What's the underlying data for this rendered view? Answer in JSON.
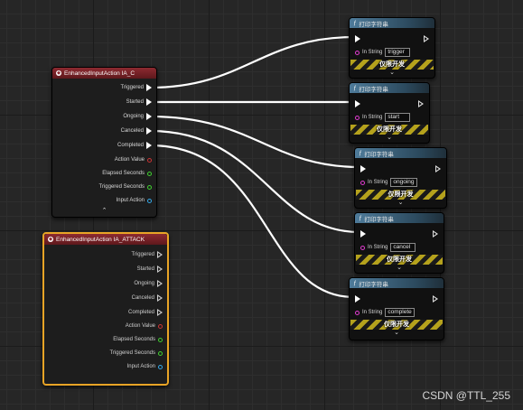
{
  "nodes": {
    "ia_c": {
      "title": "EnhancedInputAction IA_C",
      "pins": [
        "Triggered",
        "Started",
        "Ongoing",
        "Canceled",
        "Completed",
        "Action Value",
        "Elapsed Seconds",
        "Triggered Seconds",
        "Input Action"
      ],
      "collapse_glyph": "⌃"
    },
    "ia_attack": {
      "title": "EnhancedInputAction IA_ATTACK",
      "pins": [
        "Triggered",
        "Started",
        "Ongoing",
        "Canceled",
        "Completed",
        "Action Value",
        "Elapsed Seconds",
        "Triggered Seconds",
        "Input Action"
      ],
      "collapse_glyph": "⌃"
    },
    "print_nodes": [
      {
        "title": "打印字符串",
        "in_label": "In String",
        "value": "trigger",
        "dev_label": "仅限开发",
        "chev": "⌄"
      },
      {
        "title": "打印字符串",
        "in_label": "In String",
        "value": "start",
        "dev_label": "仅限开发",
        "chev": "⌄"
      },
      {
        "title": "打印字符串",
        "in_label": "In String",
        "value": "ongoing",
        "dev_label": "仅限开发",
        "chev": "⌄"
      },
      {
        "title": "打印字符串",
        "in_label": "In String",
        "value": "cancel",
        "dev_label": "仅限开发",
        "chev": "⌄"
      },
      {
        "title": "打印字符串",
        "in_label": "In String",
        "value": "complete",
        "dev_label": "仅限开发",
        "chev": "⌄"
      }
    ]
  },
  "icons": {
    "event": "event-node-icon",
    "function": "function-f-icon"
  },
  "colors": {
    "grid_bg": "#262626",
    "event_header": "#8d2a31",
    "print_header": "#4e7b9a",
    "selected_border": "#e8a426",
    "string_pin": "#e23bd0",
    "float_pin": "#3fd12f",
    "object_pin": "#35a8e8",
    "struct_pin": "#cc3333",
    "wire": "#ffffff",
    "dev_stripe": "#b5a21c"
  },
  "watermark": "CSDN @TTL_255"
}
